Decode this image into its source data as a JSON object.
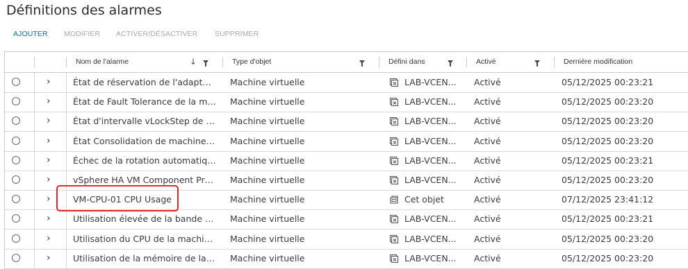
{
  "title": "Définitions des alarmes",
  "toolbar": {
    "add": "AJOUTER",
    "modify": "MODIFIER",
    "toggle": "ACTIVER/DÉSACTIVER",
    "delete": "SUPPRIMER"
  },
  "columns": {
    "name": "Nom de l'alarme",
    "type": "Type d'objet",
    "defined_in": "Défini dans",
    "enabled": "Activé",
    "modified": "Dernière modification"
  },
  "rows": [
    {
      "name": "État de réservation de l'adaptat...",
      "type": "Machine virtuelle",
      "defined_in": "LAB-VCEN...",
      "defined_icon": "vcenter-icon",
      "enabled": "Activé",
      "modified": "05/12/2025 00:23:21"
    },
    {
      "name": "État de Fault Tolerance de la ma...",
      "type": "Machine virtuelle",
      "defined_in": "LAB-VCEN...",
      "defined_icon": "vcenter-icon",
      "enabled": "Activé",
      "modified": "05/12/2025 00:23:20"
    },
    {
      "name": "État d'intervalle vLockStep de la ...",
      "type": "Machine virtuelle",
      "defined_in": "LAB-VCEN...",
      "defined_icon": "vcenter-icon",
      "enabled": "Activé",
      "modified": "05/12/2025 00:23:20"
    },
    {
      "name": "État Consolidation de machine vi...",
      "type": "Machine virtuelle",
      "defined_in": "LAB-VCEN...",
      "defined_icon": "vcenter-icon",
      "enabled": "Activé",
      "modified": "05/12/2025 00:23:20"
    },
    {
      "name": "Échec de la rotation automatiqu...",
      "type": "Machine virtuelle",
      "defined_in": "LAB-VCEN...",
      "defined_icon": "vcenter-icon",
      "enabled": "Activé",
      "modified": "05/12/2025 00:23:21"
    },
    {
      "name": "vSphere HA VM Component Pro...",
      "type": "Machine virtuelle",
      "defined_in": "LAB-VCEN...",
      "defined_icon": "vcenter-icon",
      "enabled": "Activé",
      "modified": "05/12/2025 00:23:20"
    },
    {
      "name": "VM-CPU-01 CPU Usage",
      "type": "Machine virtuelle",
      "defined_in": "Cet objet",
      "defined_icon": "vm-object-icon",
      "enabled": "Activé",
      "modified": "07/12/2025 23:41:12"
    },
    {
      "name": "Utilisation élevée de la bande pa...",
      "type": "Machine virtuelle",
      "defined_in": "LAB-VCEN...",
      "defined_icon": "vcenter-icon",
      "enabled": "Activé",
      "modified": "05/12/2025 00:23:21"
    },
    {
      "name": "Utilisation du CPU de la machine...",
      "type": "Machine virtuelle",
      "defined_in": "LAB-VCEN...",
      "defined_icon": "vcenter-icon",
      "enabled": "Activé",
      "modified": "05/12/2025 00:23:20"
    },
    {
      "name": "Utilisation de la mémoire de la m...",
      "type": "Machine virtuelle",
      "defined_in": "LAB-VCEN...",
      "defined_icon": "vcenter-icon",
      "enabled": "Activé",
      "modified": "05/12/2025 00:23:20"
    }
  ],
  "colors": {
    "accent": "#0072a3",
    "disabled": "#a9a9a9",
    "highlight": "#e3262b"
  }
}
